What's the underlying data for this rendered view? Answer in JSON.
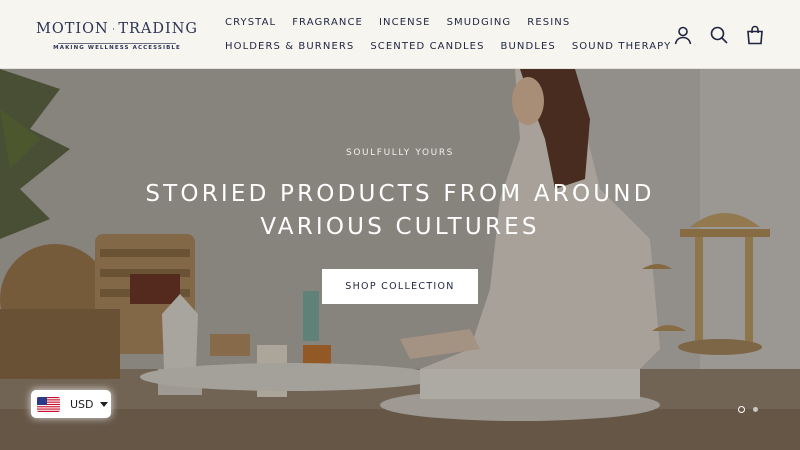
{
  "brand": {
    "name_left": "MOTION",
    "name_right": "TRADING",
    "tagline": "MAKING WELLNESS ACCESSIBLE"
  },
  "nav": {
    "row1": [
      "CRYSTAL",
      "FRAGRANCE",
      "INCENSE",
      "SMUDGING",
      "RESINS"
    ],
    "row2": [
      "HOLDERS & BURNERS",
      "SCENTED CANDLES",
      "BUNDLES",
      "SOUND THERAPY"
    ]
  },
  "header_icons": [
    "account-icon",
    "search-icon",
    "cart-icon"
  ],
  "hero": {
    "subtitle": "SOULFULLY YOURS",
    "title": "STORIED PRODUCTS FROM AROUND VARIOUS CULTURES",
    "cta_label": "SHOP COLLECTION",
    "slide_count": 2,
    "active_slide": 1
  },
  "currency": {
    "code": "USD",
    "flag": "us-flag-icon"
  },
  "colors": {
    "brand_navy": "#2d3452",
    "header_bg": "#f6f5f0",
    "cta_bg": "#ffffff"
  }
}
